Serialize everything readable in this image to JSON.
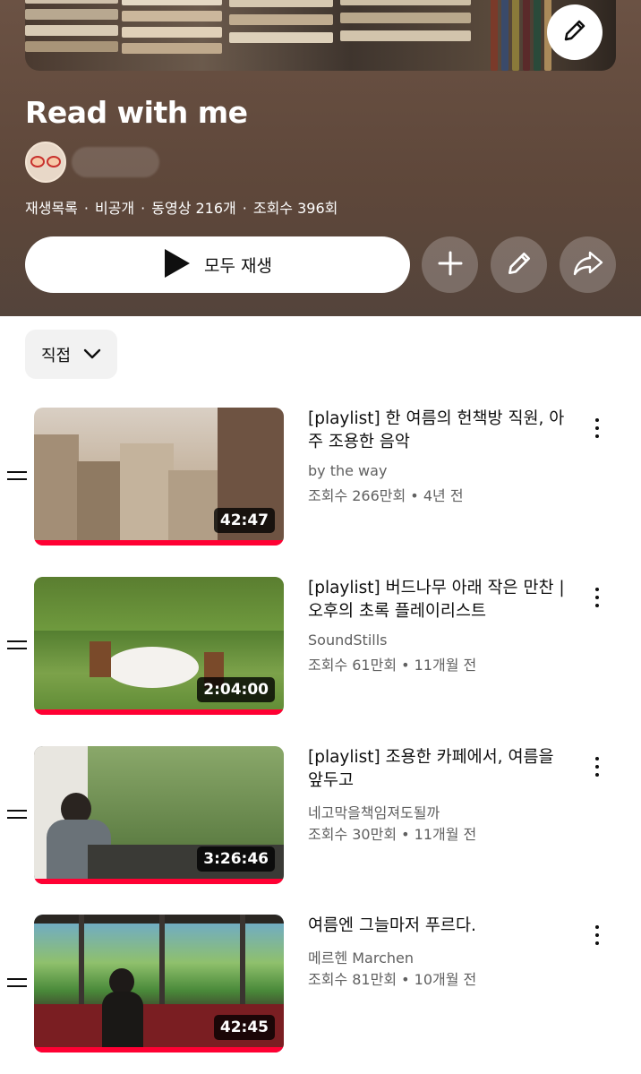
{
  "playlist": {
    "title": "Read with me",
    "meta": {
      "type": "재생목록",
      "visibility": "비공개",
      "video_count": "동영상 216개",
      "views": "조회수 396회"
    },
    "play_all_label": "모두 재생"
  },
  "icons": {
    "cover_edit": "pencil-icon",
    "play": "play-icon",
    "add": "plus-icon",
    "edit": "pencil-icon",
    "share": "share-icon",
    "sort": "chevron-down-icon",
    "more": "more-vert-icon",
    "drag": "drag-handle-icon"
  },
  "sort": {
    "label": "직접"
  },
  "colors": {
    "progress": "#ff0033",
    "header_bg": "#5e473a"
  },
  "videos": [
    {
      "title": "[playlist] 한 여름의 헌책방 직원, 아주 조용한 음악",
      "channel": "by the way",
      "stats": "조회수 266만회 • 4년 전",
      "duration": "42:47",
      "watched": 1.0
    },
    {
      "title": "[playlist] 버드나무 아래 작은 만찬 | 오후의 초록 플레이리스트",
      "channel": "SoundStills",
      "stats": "조회수 61만회 • 11개월 전",
      "duration": "2:04:00",
      "watched": 1.0
    },
    {
      "title": "[playlist] 조용한 카페에서, 여름을 앞두고",
      "channel": "네고막을책임져도될까",
      "stats": "조회수 30만회 • 11개월 전",
      "duration": "3:26:46",
      "watched": 1.0
    },
    {
      "title": "여름엔 그늘마저 푸르다.",
      "channel": "메르헨 Marchen",
      "stats": "조회수 81만회 • 10개월 전",
      "duration": "42:45",
      "watched": 1.0
    }
  ]
}
